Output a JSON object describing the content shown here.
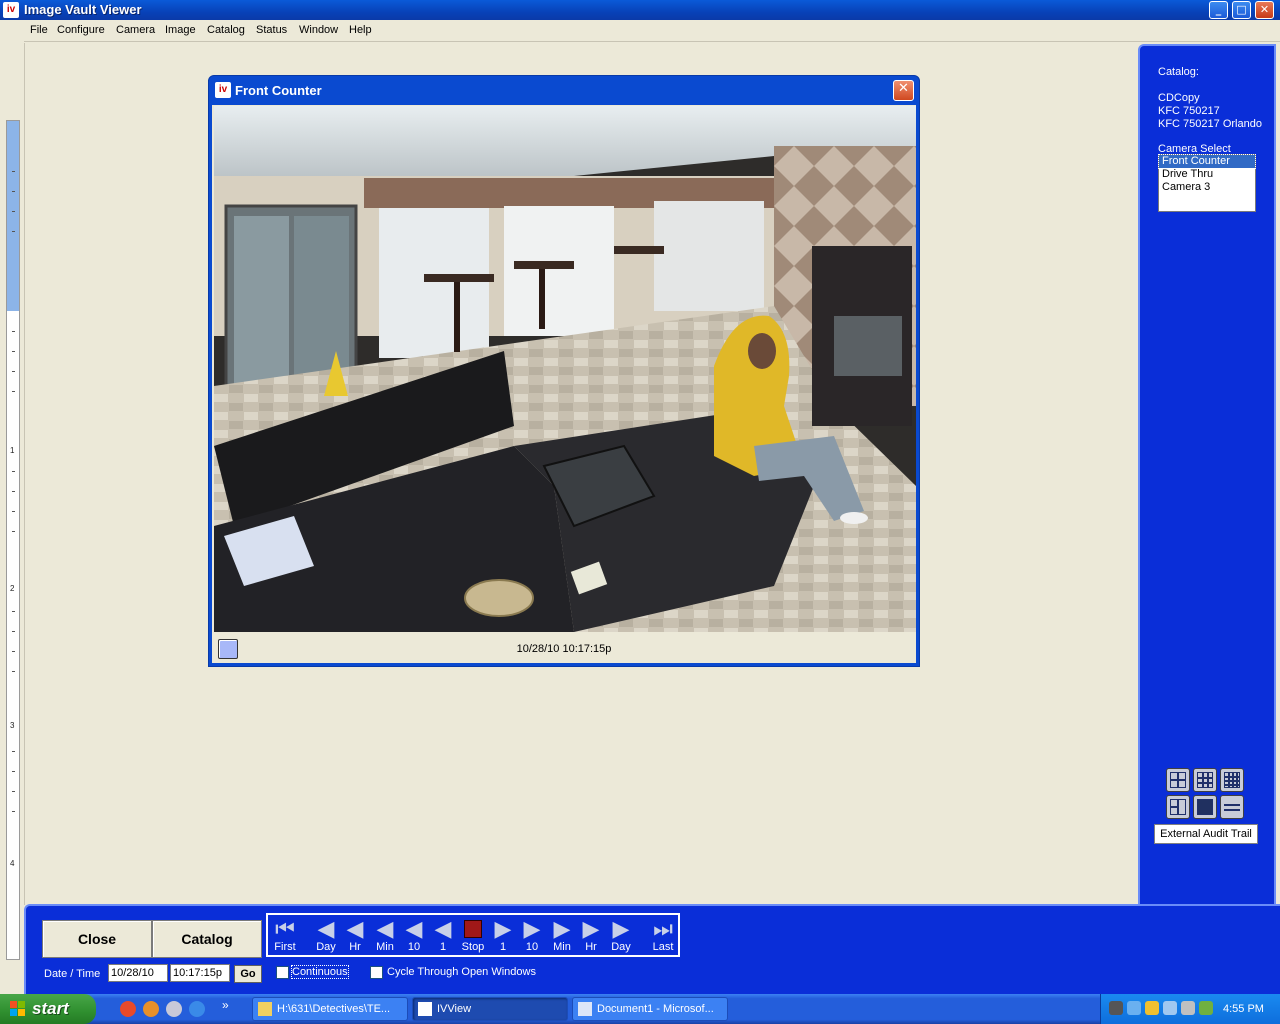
{
  "window": {
    "title": "Image Vault Viewer",
    "app_icon_text": "iv",
    "minimize": "_",
    "maximize": "□",
    "close": "✕"
  },
  "menu": {
    "items": [
      "File",
      "Configure",
      "Camera",
      "Image",
      "Catalog",
      "Status",
      "Window",
      "Help"
    ]
  },
  "camera_window": {
    "title": "Front Counter",
    "icon_text": "iv",
    "close": "✕",
    "timestamp": "10/28/10 10:17:15p"
  },
  "right_panel": {
    "catalog_label": "Catalog:",
    "catalog_lines": [
      "CDCopy",
      "KFC  750217",
      "KFC 750217 Orlando"
    ],
    "camera_select_label": "Camera Select",
    "cameras": [
      "Front Counter",
      "Drive Thru",
      "Camera 3"
    ],
    "selected_camera": "Front Counter",
    "audit_button": "External Audit Trail"
  },
  "bottom": {
    "close_label": "Close",
    "catalog_label": "Catalog",
    "transport": [
      {
        "label": "First",
        "icon": "skip-first-icon"
      },
      {
        "label": "Day",
        "icon": "step-back-icon"
      },
      {
        "label": "Hr",
        "icon": "step-back-icon"
      },
      {
        "label": "Min",
        "icon": "step-back-icon"
      },
      {
        "label": "10",
        "icon": "step-back-icon"
      },
      {
        "label": "1",
        "icon": "step-back-icon"
      },
      {
        "label": "Stop",
        "icon": "stop-icon"
      },
      {
        "label": "1",
        "icon": "step-forward-icon"
      },
      {
        "label": "10",
        "icon": "step-forward-icon"
      },
      {
        "label": "Min",
        "icon": "step-forward-icon"
      },
      {
        "label": "Hr",
        "icon": "step-forward-icon"
      },
      {
        "label": "Day",
        "icon": "step-forward-icon"
      },
      {
        "label": "Last",
        "icon": "skip-last-icon"
      }
    ],
    "date_time_label": "Date / Time",
    "date_value": "10/28/10",
    "time_value": "10:17:15p",
    "go_label": "Go",
    "continuous_label": "Continuous",
    "cycle_label": "Cycle Through Open Windows"
  },
  "taskbar": {
    "start_label": "start",
    "items": [
      {
        "label": "H:\\631\\Detectives\\TE...",
        "icon": "folder-icon"
      },
      {
        "label": "IVView",
        "icon": "iv-app-icon"
      },
      {
        "label": "Document1 - Microsof...",
        "icon": "word-doc-icon"
      }
    ],
    "chevron": "»",
    "clock": "4:55 PM"
  },
  "ruler": {
    "numbers": [
      "1",
      "2",
      "3",
      "4"
    ]
  },
  "colors": {
    "panel_blue": "#0a2ed8",
    "title_blue": "#0842b8",
    "client_bg": "#ece9d8",
    "selection": "#316ac5",
    "stop_red": "#a01818"
  }
}
